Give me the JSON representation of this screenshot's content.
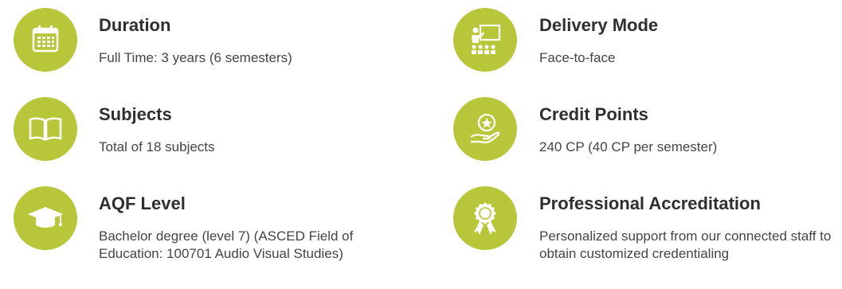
{
  "items": [
    {
      "title": "Duration",
      "desc": "Full Time: 3 years (6 semesters)",
      "icon": "calendar-icon"
    },
    {
      "title": "Subjects",
      "desc": "Total of 18 subjects",
      "icon": "book-icon"
    },
    {
      "title": "AQF Level",
      "desc": "Bachelor degree (level 7) (ASCED Field of Education: 100701 Audio Visual Studies)",
      "icon": "graduation-cap-icon"
    },
    {
      "title": "Delivery Mode",
      "desc": "Face-to-face",
      "icon": "classroom-presentation-icon"
    },
    {
      "title": "Credit Points",
      "desc": "240 CP (40 CP per semester)",
      "icon": "hand-star-award-icon"
    },
    {
      "title": "Professional Accreditation",
      "desc": "Personalized support from our connected staff to obtain customized credentialing",
      "icon": "rosette-award-icon"
    }
  ],
  "colors": {
    "accent": "#b8c73a",
    "title": "#2f2f2f",
    "text": "#444444"
  }
}
